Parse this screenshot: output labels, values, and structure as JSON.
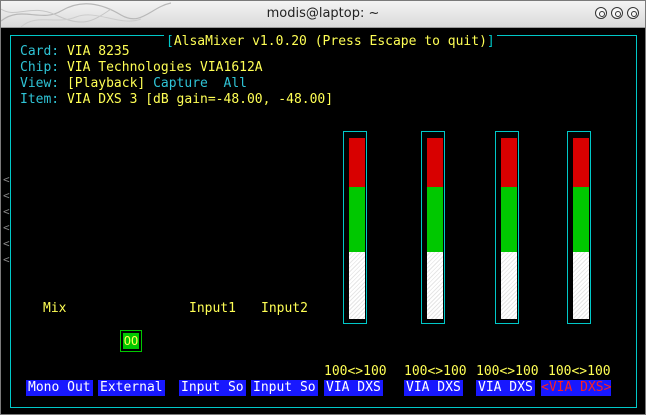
{
  "window": {
    "title": "modis@laptop: ~"
  },
  "app": {
    "title": "AlsaMixer v1.0.20 (Press Escape to quit)"
  },
  "info": {
    "card_label": "Card:",
    "card_value": "VIA 8235",
    "chip_label": "Chip:",
    "chip_value": "VIA Technologies VIA1612A",
    "view_label": "View:",
    "view_playback": "[Playback]",
    "view_capture": "Capture",
    "view_all": "All",
    "item_label": "Item:",
    "item_value": "VIA DXS 3 [dB gain=-48.00, -48.00]"
  },
  "controls": {
    "mix_label": "Mix",
    "input1_label": "Input1",
    "input2_label": "Input2",
    "mono_out_toggle": "OO"
  },
  "channels": [
    {
      "name": "Mono Out"
    },
    {
      "name": "External"
    },
    {
      "name": "Input So"
    },
    {
      "name": "Input So"
    },
    {
      "name": "VIA DXS",
      "value": "100<>100",
      "level": 1.0
    },
    {
      "name": "VIA DXS",
      "value": "100<>100",
      "level": 1.0
    },
    {
      "name": "VIA DXS",
      "value": "100<>100",
      "level": 1.0
    },
    {
      "name": "VIA DXS",
      "value": "100<>100",
      "level": 1.0,
      "selected": true
    }
  ],
  "selected_marker": {
    "left": "<",
    "right": ">"
  },
  "colors": {
    "terminal_bg": "#000000",
    "frame": "#00c8c8",
    "label_bg": "#1818ff",
    "meter_red": "#d80000",
    "meter_green": "#00c800",
    "text_yellow": "#ffff55",
    "text_cyan": "#2fc4d6"
  }
}
